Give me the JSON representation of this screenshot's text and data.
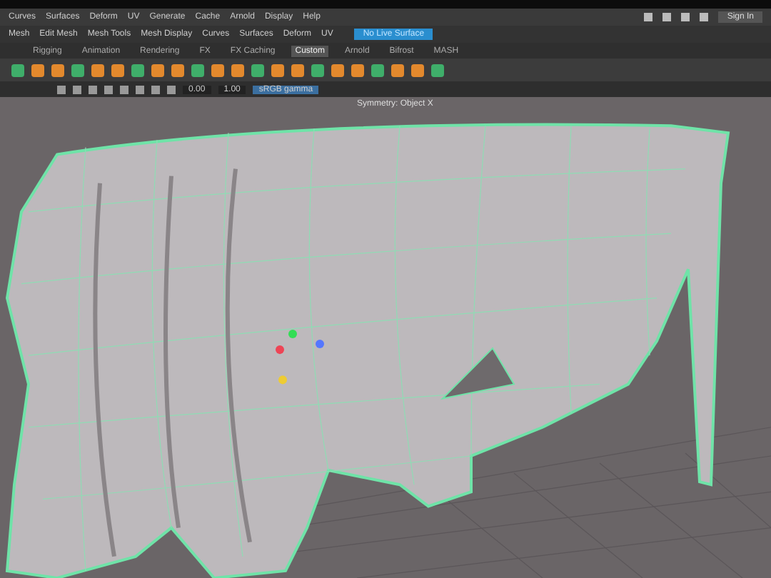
{
  "main_menu": [
    "Curves",
    "Surfaces",
    "Deform",
    "UV",
    "Generate",
    "Cache",
    "Arnold",
    "Display",
    "Help"
  ],
  "account": {
    "label": "Sign In"
  },
  "module_menu": [
    "Mesh",
    "Edit Mesh",
    "Mesh Tools",
    "Mesh Display",
    "Curves",
    "Surfaces",
    "Deform",
    "UV"
  ],
  "status_line": {
    "live_surface": "No Live Surface"
  },
  "shelf_tabs": [
    {
      "label": "Rigging",
      "selected": false
    },
    {
      "label": "Animation",
      "selected": false
    },
    {
      "label": "Rendering",
      "selected": false
    },
    {
      "label": "FX",
      "selected": false
    },
    {
      "label": "FX Caching",
      "selected": false
    },
    {
      "label": "Custom",
      "selected": true
    },
    {
      "label": "Arnold",
      "selected": false
    },
    {
      "label": "Bifrost",
      "selected": false
    },
    {
      "label": "MASH",
      "selected": false
    }
  ],
  "viewport": {
    "panel_fields": [
      "0.00",
      "1.00"
    ],
    "color_space": "sRGB gamma",
    "symmetry": "Symmetry: Object X"
  }
}
